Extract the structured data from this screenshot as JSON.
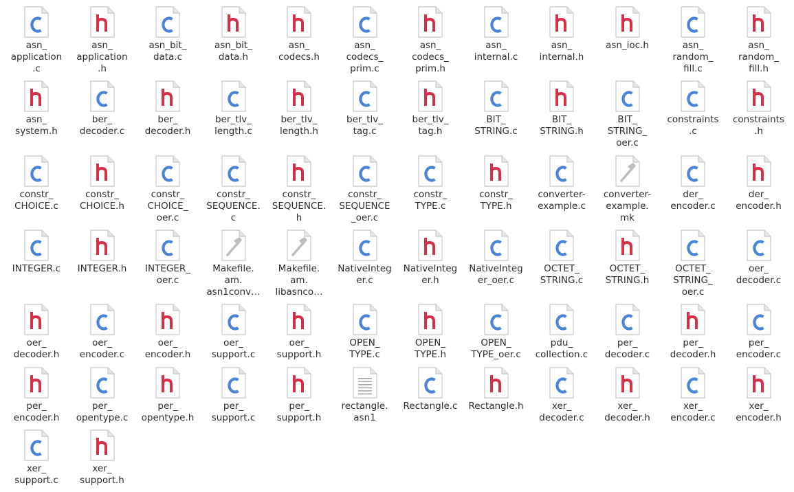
{
  "colors": {
    "c_letter": "#4a84d6",
    "h_letter": "#d4304a",
    "page_fill": "#ffffff",
    "page_edge": "#c8c8c8",
    "page_fold": "#e6e6e6",
    "hammer": "#bdbdbd",
    "text_lines": "#a9a9a9"
  },
  "files": [
    {
      "type": "c",
      "label": "asn_\napplication\n.c"
    },
    {
      "type": "h",
      "label": "asn_\napplication\n.h"
    },
    {
      "type": "c",
      "label": "asn_bit_\ndata.c"
    },
    {
      "type": "h",
      "label": "asn_bit_\ndata.h"
    },
    {
      "type": "h",
      "label": "asn_\ncodecs.h"
    },
    {
      "type": "c",
      "label": "asn_\ncodecs_\nprim.c"
    },
    {
      "type": "h",
      "label": "asn_\ncodecs_\nprim.h"
    },
    {
      "type": "c",
      "label": "asn_\ninternal.c"
    },
    {
      "type": "h",
      "label": "asn_\ninternal.h"
    },
    {
      "type": "h",
      "label": "asn_ioc.h"
    },
    {
      "type": "c",
      "label": "asn_\nrandom_\nfill.c"
    },
    {
      "type": "h",
      "label": "asn_\nrandom_\nfill.h"
    },
    {
      "type": "h",
      "label": "asn_\nsystem.h"
    },
    {
      "type": "c",
      "label": "ber_\ndecoder.c"
    },
    {
      "type": "h",
      "label": "ber_\ndecoder.h"
    },
    {
      "type": "c",
      "label": "ber_tlv_\nlength.c"
    },
    {
      "type": "h",
      "label": "ber_tlv_\nlength.h"
    },
    {
      "type": "c",
      "label": "ber_tlv_\ntag.c"
    },
    {
      "type": "h",
      "label": "ber_tlv_\ntag.h"
    },
    {
      "type": "c",
      "label": "BIT_\nSTRING.c"
    },
    {
      "type": "h",
      "label": "BIT_\nSTRING.h"
    },
    {
      "type": "c",
      "label": "BIT_\nSTRING_\noer.c"
    },
    {
      "type": "c",
      "label": "constraints\n.c"
    },
    {
      "type": "h",
      "label": "constraints\n.h"
    },
    {
      "type": "c",
      "label": "constr_\nCHOICE.c"
    },
    {
      "type": "h",
      "label": "constr_\nCHOICE.h"
    },
    {
      "type": "c",
      "label": "constr_\nCHOICE_\noer.c"
    },
    {
      "type": "c",
      "label": "constr_\nSEQUENCE.\nc"
    },
    {
      "type": "h",
      "label": "constr_\nSEQUENCE.\nh"
    },
    {
      "type": "c",
      "label": "constr_\nSEQUENCE\n_oer.c"
    },
    {
      "type": "c",
      "label": "constr_\nTYPE.c"
    },
    {
      "type": "h",
      "label": "constr_\nTYPE.h"
    },
    {
      "type": "c",
      "label": "converter-\nexample.c"
    },
    {
      "type": "mk",
      "label": "converter-\nexample.\nmk"
    },
    {
      "type": "c",
      "label": "der_\nencoder.c"
    },
    {
      "type": "h",
      "label": "der_\nencoder.h"
    },
    {
      "type": "c",
      "label": "INTEGER.c"
    },
    {
      "type": "h",
      "label": "INTEGER.h"
    },
    {
      "type": "c",
      "label": "INTEGER_\noer.c"
    },
    {
      "type": "mk",
      "label": "Makefile.\nam.\nasn1conv…"
    },
    {
      "type": "mk",
      "label": "Makefile.\nam.\nlibasnco…"
    },
    {
      "type": "c",
      "label": "NativeInteg\ner.c"
    },
    {
      "type": "h",
      "label": "NativeInteg\ner.h"
    },
    {
      "type": "c",
      "label": "NativeInteg\ner_oer.c"
    },
    {
      "type": "c",
      "label": "OCTET_\nSTRING.c"
    },
    {
      "type": "h",
      "label": "OCTET_\nSTRING.h"
    },
    {
      "type": "c",
      "label": "OCTET_\nSTRING_\noer.c"
    },
    {
      "type": "c",
      "label": "oer_\ndecoder.c"
    },
    {
      "type": "h",
      "label": "oer_\ndecoder.h"
    },
    {
      "type": "c",
      "label": "oer_\nencoder.c"
    },
    {
      "type": "h",
      "label": "oer_\nencoder.h"
    },
    {
      "type": "c",
      "label": "oer_\nsupport.c"
    },
    {
      "type": "h",
      "label": "oer_\nsupport.h"
    },
    {
      "type": "c",
      "label": "OPEN_\nTYPE.c"
    },
    {
      "type": "h",
      "label": "OPEN_\nTYPE.h"
    },
    {
      "type": "c",
      "label": "OPEN_\nTYPE_oer.c"
    },
    {
      "type": "c",
      "label": "pdu_\ncollection.c"
    },
    {
      "type": "c",
      "label": "per_\ndecoder.c"
    },
    {
      "type": "h",
      "label": "per_\ndecoder.h"
    },
    {
      "type": "c",
      "label": "per_\nencoder.c"
    },
    {
      "type": "h",
      "label": "per_\nencoder.h"
    },
    {
      "type": "c",
      "label": "per_\nopentype.c"
    },
    {
      "type": "h",
      "label": "per_\nopentype.h"
    },
    {
      "type": "c",
      "label": "per_\nsupport.c"
    },
    {
      "type": "h",
      "label": "per_\nsupport.h"
    },
    {
      "type": "txt",
      "label": "rectangle.\nasn1"
    },
    {
      "type": "c",
      "label": "Rectangle.c"
    },
    {
      "type": "h",
      "label": "Rectangle.h"
    },
    {
      "type": "c",
      "label": "xer_\ndecoder.c"
    },
    {
      "type": "h",
      "label": "xer_\ndecoder.h"
    },
    {
      "type": "c",
      "label": "xer_\nencoder.c"
    },
    {
      "type": "h",
      "label": "xer_\nencoder.h"
    },
    {
      "type": "c",
      "label": "xer_\nsupport.c"
    },
    {
      "type": "h",
      "label": "xer_\nsupport.h"
    }
  ]
}
